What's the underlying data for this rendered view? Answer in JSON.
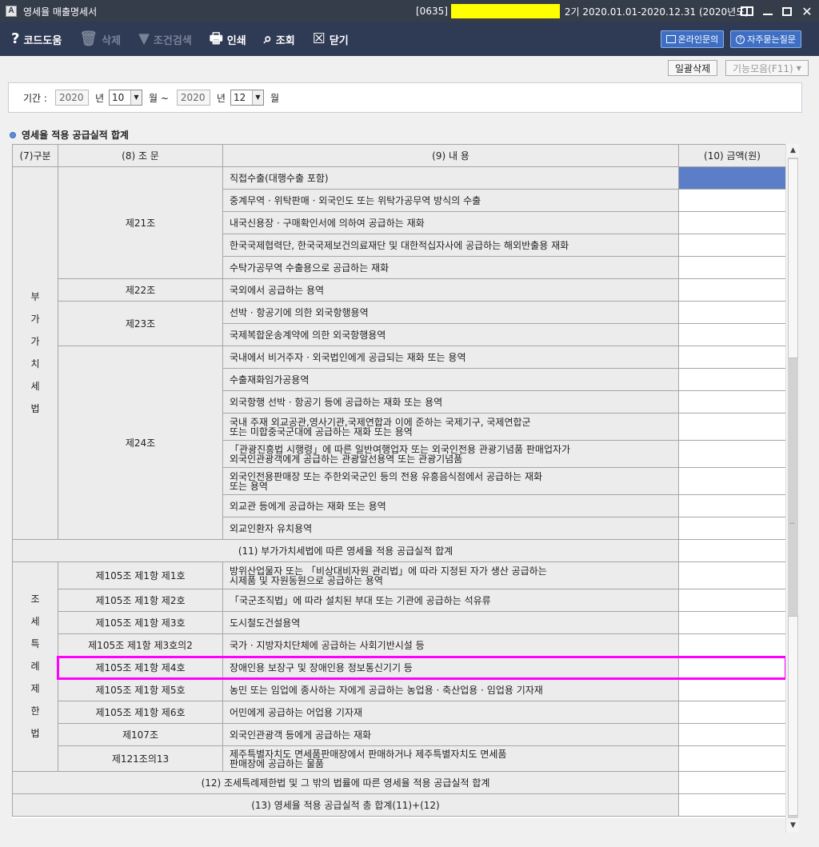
{
  "window": {
    "title": "영세율 매출명세서",
    "company_code": "[0635]",
    "period_label": "2기 2020.01.01-2020.12.31 (2020년도)"
  },
  "toolbar": {
    "code_help": "코드도움",
    "delete": "삭제",
    "search_filter": "조건검색",
    "print": "인쇄",
    "view": "조회",
    "close": "닫기",
    "online_inquiry": "온라인문의",
    "faq": "자주묻는질문"
  },
  "subbar": {
    "bulk_delete": "일괄삭제",
    "functions": "기능모음(F11)"
  },
  "period": {
    "label": "기간 :",
    "from_year": "2020",
    "year_unit": "년",
    "from_month": "10",
    "month_unit_range": "월 ~",
    "to_year": "2020",
    "to_month": "12",
    "month_unit": "월"
  },
  "section_title": "영세율 적용 공급실적 합계",
  "table": {
    "headers": [
      "(7)구분",
      "(8) 조    문",
      "(9) 내                  용",
      "(10) 금액(원)"
    ],
    "group_vat": "부가가치세법",
    "group_special": "조세특례제한법",
    "articles": {
      "a21": "제21조",
      "a22": "제22조",
      "a23": "제23조",
      "a24": "제24조",
      "s1": "제105조 제1항 제1호",
      "s2": "제105조 제1항 제2호",
      "s3": "제105조 제1항 제3호",
      "s3_2": "제105조 제1항 제3호의2",
      "s4": "제105조 제1항 제4호",
      "s5": "제105조 제1항 제5호",
      "s6": "제105조 제1항 제6호",
      "s107": "제107조",
      "s121": "제121조의13"
    },
    "rows": [
      {
        "desc": "직접수출(대행수출 포함)"
      },
      {
        "desc": "중계무역 · 위탁판매 · 외국인도 또는 위탁가공무역 방식의 수출"
      },
      {
        "desc": "내국신용장 · 구매확인서에 의하여 공급하는 재화"
      },
      {
        "desc": "한국국제협력단, 한국국제보건의료재단 및 대한적십자사에 공급하는 해외반출용 재화"
      },
      {
        "desc": "수탁가공무역 수출용으로 공급하는 재화"
      },
      {
        "desc": "국외에서 공급하는 용역"
      },
      {
        "desc": "선박 · 항공기에 의한 외국항행용역"
      },
      {
        "desc": "국제복합운송계약에 의한 외국항행용역"
      },
      {
        "desc": "국내에서 비거주자 · 외국법인에게 공급되는 재화 또는 용역"
      },
      {
        "desc": "수출재화임가공용역"
      },
      {
        "desc": "외국항행 선박 · 항공기 등에 공급하는 재화 또는 용역"
      },
      {
        "desc1": "국내 주재 외교공관,영사기관,국제연합과 이에 준하는 국제기구, 국제연합군",
        "desc2": "또는 미합중국군대에 공급하는 재화 또는 용역"
      },
      {
        "desc1": "「관광진흥법 시행령」에 따른 일반여행업자 또는 외국인전용 관광기념품 판매업자가",
        "desc2": "외국인관광객에게 공급하는 관광알선용역 또는 관광기념품"
      },
      {
        "desc1": "외국인전용판매장 또는 주한외국군인 등의 전용 유흥음식점에서 공급하는 재화",
        "desc2": "또는 용역"
      },
      {
        "desc": "외교관 등에게 공급하는 재화 또는 용역"
      },
      {
        "desc": "외교인환자 유치용역"
      },
      {
        "desc": "(11) 부가가치세법에 따른 영세율 적용 공급실적 합계"
      },
      {
        "desc1": "방위산업물자 또는 「비상대비자원 관리법」에 따라 지정된 자가 생산 공급하는",
        "desc2": "시제품 및 자원동원으로 공급하는 용역"
      },
      {
        "desc": "「국군조직법」에 따라 설치된 부대 또는 기관에 공급하는 석유류"
      },
      {
        "desc": "도시철도건설용역"
      },
      {
        "desc": "국가 · 지방자치단체에 공급하는 사회기반시설 등"
      },
      {
        "desc": "장애인용 보장구 및 장애인용 정보통신기기 등"
      },
      {
        "desc": "농민 또는 임업에 종사하는 자에게 공급하는 농업용 · 축산업용 · 임업용 기자재"
      },
      {
        "desc": "어민에게 공급하는 어업용 기자재"
      },
      {
        "desc": "외국인관광객 등에게 공급하는 재화"
      },
      {
        "desc1": "제주특별자치도 면세품판매장에서 판매하거나 제주특별자치도 면세품",
        "desc2": "판매장에 공급하는 물품"
      },
      {
        "desc": "(12) 조세특례제한법 및 그 밖의 법률에 따른 영세율 적용 공급실적 합계"
      },
      {
        "desc": "(13) 영세율 적용 공급실적 총 합계(11)+(12)"
      }
    ]
  },
  "colors": {
    "titlebar": "#353c4a",
    "toolbar": "#2f3a55",
    "highlight_yellow": "#ffff00",
    "selected_cell": "#5c7ec8",
    "row_highlight": "#ff00ff"
  }
}
